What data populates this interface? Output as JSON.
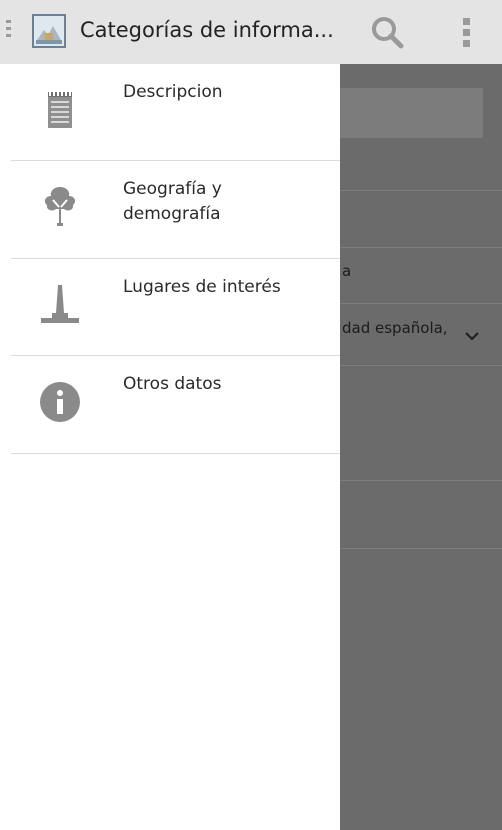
{
  "header": {
    "title": "Categorías de informa...",
    "nav_icon": "drawer-indicator-icon",
    "app_icon": "app-logo-icon",
    "search_icon": "search-icon",
    "overflow_icon": "overflow-menu-icon"
  },
  "drawer": {
    "items": [
      {
        "label": "Descripcion",
        "icon": "notepad-icon"
      },
      {
        "label": "Geografía y demografía",
        "icon": "tree-icon"
      },
      {
        "label": "Lugares de interés",
        "icon": "monument-icon"
      },
      {
        "label": "Otros datos",
        "icon": "info-icon"
      }
    ]
  },
  "background": {
    "fragment_1": "a",
    "fragment_2": "dad española,"
  },
  "colors": {
    "actionbar": "#e4e4e4",
    "scrim": "#6b6b6b",
    "drawer": "#ffffff",
    "icon_gray": "#9a9a9a"
  }
}
